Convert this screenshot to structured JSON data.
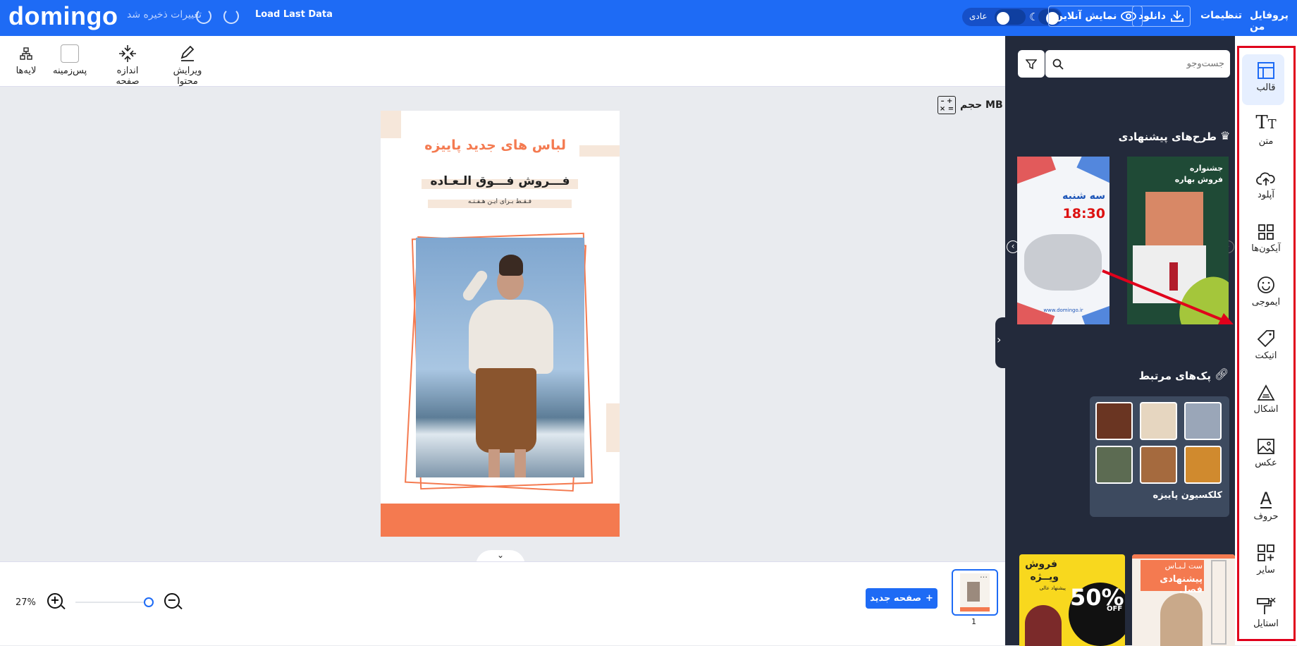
{
  "topbar": {
    "logo": "domingo",
    "saved_text": "تغییرات ذخیره شد",
    "load_last": "Load Last Data",
    "mode_label": "عادی",
    "online_preview": "نمایش آنلاین",
    "download": "دانلود",
    "settings": "تنظیمات",
    "profile": "پروفایل من"
  },
  "toolbar": {
    "edit_content": "ویرایش محتوا",
    "page_size": "اندازه صفحه",
    "background": "پس‌زمینه",
    "layers": "لایه‌ها"
  },
  "canvas": {
    "size_label": "حجم MB",
    "design": {
      "title": "لباس های جدید پاییزه",
      "headline": "فـــروش فـــوق الـعـاده",
      "subline": "فـقـط بـرای ایـن هـفـتـه"
    }
  },
  "bottom": {
    "zoom": "27%",
    "zoom_level": 0.27,
    "new_page": "صفحه جدید",
    "page_number": "1"
  },
  "panel": {
    "search_placeholder": "جست‌وجو",
    "suggested_title": "طرح‌های پیشنهادی",
    "template1": {
      "line1": "جشنواره",
      "line2": "فروش بهاره"
    },
    "template2": {
      "title": "سه شنبه",
      "time": "18:30",
      "site": "www.domingo.ir"
    },
    "related_title": "پک‌های مرتبط",
    "collection_name": "کلکسیون پاییزه",
    "card1": {
      "line1": "فروش",
      "line2": "ویــژه",
      "small": "پیشنهاد عالی",
      "big": "50%",
      "off": "OFF"
    },
    "card2": {
      "line1": "ست لـبـاس",
      "line2": "پیشنهادی فصل"
    }
  },
  "sidebar": {
    "items": [
      {
        "label": "قالب",
        "icon": "template-icon"
      },
      {
        "label": "متن",
        "icon": "text-icon"
      },
      {
        "label": "آپلود",
        "icon": "upload-icon"
      },
      {
        "label": "آیکون‌ها",
        "icon": "grid-icon"
      },
      {
        "label": "ایموجی",
        "icon": "emoji-icon"
      },
      {
        "label": "اتیکت",
        "icon": "tag-icon"
      },
      {
        "label": "اشکال",
        "icon": "shapes-icon"
      },
      {
        "label": "عکس",
        "icon": "image-icon"
      },
      {
        "label": "حروف",
        "icon": "letters-icon"
      },
      {
        "label": "سایر",
        "icon": "more-icon"
      },
      {
        "label": "استایل",
        "icon": "paint-roller-icon"
      }
    ]
  },
  "colors": {
    "brand": "#1e6bf5",
    "accent_orange": "#f47a50",
    "annotation": "#e0001b",
    "panel": "#232a3b"
  }
}
